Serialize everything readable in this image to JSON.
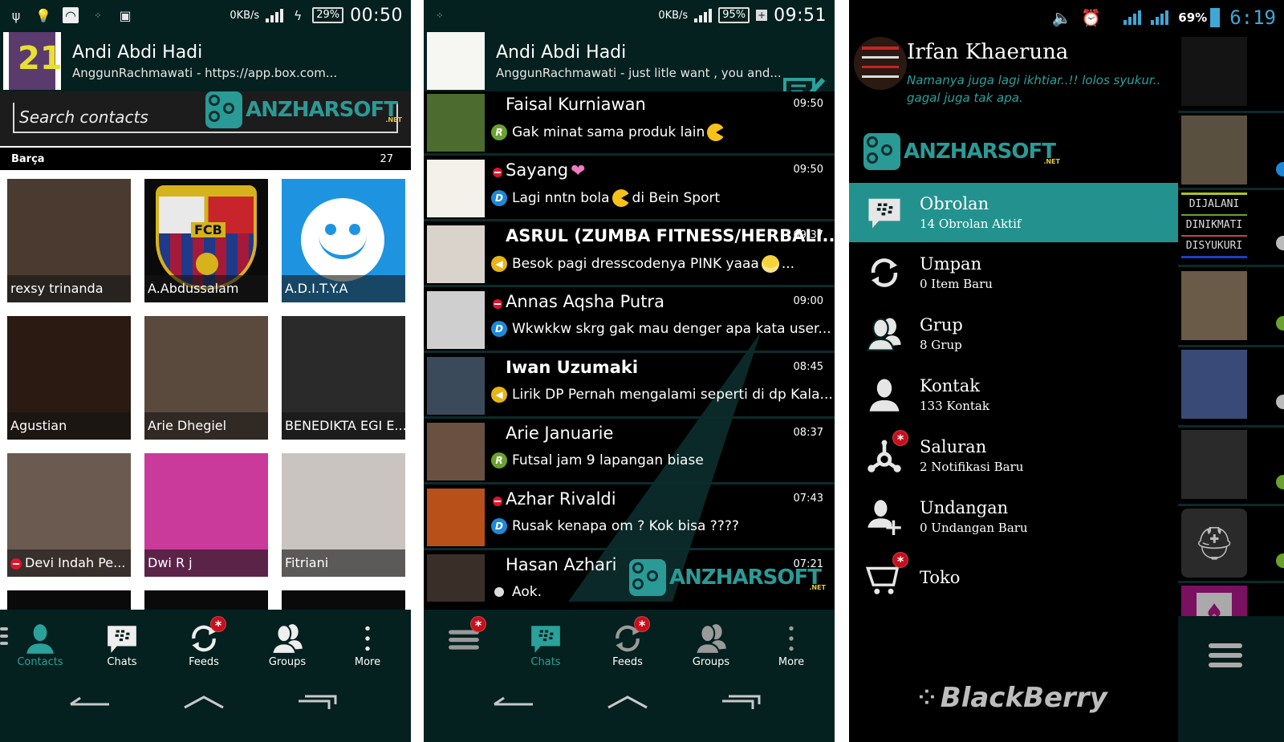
{
  "panel1": {
    "status": {
      "left_icons": [
        "usb-icon",
        "bulb-icon",
        "wifi-icon",
        "blackberry-icon",
        "android-icon"
      ],
      "speed": "0KB/s",
      "network": "H",
      "battery": "29%",
      "charging": true,
      "clock": "00:50"
    },
    "profile": {
      "name": "Andi Abdi Hadi",
      "status": "AnggunRachmawati - https://app.box.com..."
    },
    "search": {
      "placeholder": "Search contacts"
    },
    "group": {
      "name": "Barça",
      "count": "27"
    },
    "contacts": [
      {
        "name": "rexsy trinanda",
        "color": "#4a3a30",
        "dnd": false
      },
      {
        "name": "A.Abdussalam",
        "color": "#0a0a0a",
        "dnd": false
      },
      {
        "name": "A.D.I.T.Y.A",
        "color": "#1e94e0",
        "dnd": false
      },
      {
        "name": "Agustian",
        "color": "#2a1a12",
        "dnd": false
      },
      {
        "name": "Arie Dhegiel",
        "color": "#5a4a3e",
        "dnd": false
      },
      {
        "name": "BENEDIKTA EGI E...",
        "color": "#2a2a2a",
        "dnd": false
      },
      {
        "name": "Devi Indah Pe...",
        "color": "#6b5a50",
        "dnd": true
      },
      {
        "name": "Dwi R j",
        "color": "#c93a9a",
        "dnd": false
      },
      {
        "name": "Fitriani",
        "color": "#c9c4c0",
        "dnd": false
      }
    ],
    "tabs": [
      {
        "label": "Contacts",
        "icon": "contact-icon",
        "active": true,
        "badge": false
      },
      {
        "label": "Chats",
        "icon": "chat-icon",
        "active": false,
        "badge": false
      },
      {
        "label": "Feeds",
        "icon": "feeds-icon",
        "active": false,
        "badge": true
      },
      {
        "label": "Groups",
        "icon": "groups-icon",
        "active": false,
        "badge": false
      },
      {
        "label": "More",
        "icon": "more-icon",
        "active": false,
        "badge": false
      }
    ]
  },
  "panel2": {
    "status": {
      "speed": "0KB/s",
      "network": "H",
      "battery": "95%",
      "clock": "09:51"
    },
    "profile": {
      "name": "Andi Abdi Hadi",
      "status": "AnggunRachmawati - just litle want , you and..."
    },
    "chats": [
      {
        "name": "Faisal Kurniawan",
        "time": "09:50",
        "indicator": "R",
        "message": "Gak minat sama produk lain",
        "emoji": "pacman",
        "bold": false,
        "busy": false,
        "color": "#4c6b2e"
      },
      {
        "name": "Sayang",
        "name_emoji": "heart",
        "time": "09:50",
        "indicator": "D",
        "message": "Lagi nntn bola",
        "emoji": "pacman",
        "message_tail": "di Bein Sport",
        "bold": false,
        "busy": true,
        "color": "#f4f1ea"
      },
      {
        "name": "ASRUL (ZUMBA FITNESS/HERBALI...",
        "time": "09:37",
        "indicator": "B",
        "message": "Besok pagi dresscodenya PINK yaaa",
        "emoji": "grin",
        "message_tail": "...",
        "bold": true,
        "busy": false,
        "color": "#d9d3cc"
      },
      {
        "name": "Annas Aqsha Putra",
        "time": "09:00",
        "indicator": "D",
        "message": "Wkwkkw skrg gak mau denger apa kata user...",
        "bold": false,
        "busy": true,
        "color": "#cfcfcf"
      },
      {
        "name": "Iwan Uzumaki",
        "time": "08:45",
        "indicator": "B",
        "message": "Lirik DP Pernah mengalami seperti di dp Kala...",
        "bold": true,
        "busy": false,
        "color": "#3a4a5a"
      },
      {
        "name": "Arie Januarie",
        "time": "08:37",
        "indicator": "R",
        "message": "Futsal jam 9 lapangan biase",
        "bold": false,
        "busy": false,
        "color": "#6a5040"
      },
      {
        "name": "Azhar Rivaldi",
        "time": "07:43",
        "indicator": "D",
        "message": "Rusak kenapa om ? Kok bisa ????",
        "bold": false,
        "busy": true,
        "color": "#b8501a"
      },
      {
        "name": "Hasan Azhari",
        "time": "07:21",
        "indicator": "dot",
        "message": "Aok.",
        "bold": false,
        "busy": false,
        "color": "#3a2e28"
      }
    ],
    "tabs": [
      {
        "label": "",
        "icon": "menu-icon",
        "active": false,
        "badge": true
      },
      {
        "label": "Chats",
        "icon": "chat-icon",
        "active": true,
        "badge": false
      },
      {
        "label": "Feeds",
        "icon": "feeds-icon",
        "active": false,
        "badge": true
      },
      {
        "label": "Groups",
        "icon": "groups-icon",
        "active": false,
        "badge": false
      },
      {
        "label": "More",
        "icon": "more-icon",
        "active": false,
        "badge": false
      }
    ]
  },
  "panel3": {
    "status": {
      "battery": "69%",
      "network": "H",
      "clock": "6:19"
    },
    "profile": {
      "name": "Irfan Khaeruna",
      "status": "Namanya juga lagi ikhtiar..!! lolos syukur.. gagal juga tak apa."
    },
    "menu": [
      {
        "title": "Obrolan",
        "subtitle": "14 Obrolan Aktif",
        "icon": "chat-icon",
        "active": true,
        "badge": false
      },
      {
        "title": "Umpan",
        "subtitle": "0 Item Baru",
        "icon": "feeds-icon",
        "active": false,
        "badge": false
      },
      {
        "title": "Grup",
        "subtitle": "8 Grup",
        "icon": "groups-icon",
        "active": false,
        "badge": false
      },
      {
        "title": "Kontak",
        "subtitle": "133 Kontak",
        "icon": "contact-icon",
        "active": false,
        "badge": false
      },
      {
        "title": "Saluran",
        "subtitle": "2 Notifikasi Baru",
        "icon": "channels-icon",
        "active": false,
        "badge": true
      },
      {
        "title": "Undangan",
        "subtitle": "0 Undangan Baru",
        "icon": "invite-icon",
        "active": false,
        "badge": false
      },
      {
        "title": "Toko",
        "subtitle": "",
        "icon": "cart-icon",
        "active": false,
        "badge": true
      }
    ],
    "brand": "BlackBerry",
    "thumb_text": [
      "DIJALANI",
      "DINIKMATI",
      "DISYUKURI"
    ]
  },
  "watermark": {
    "text": "ANZHARSOFT",
    "suffix": ".NET",
    "tag": "NET"
  },
  "colors": {
    "accent": "#2aa19b",
    "header_bg": "#04201f",
    "badge": "#c8101c",
    "busy": "#e4122d"
  }
}
